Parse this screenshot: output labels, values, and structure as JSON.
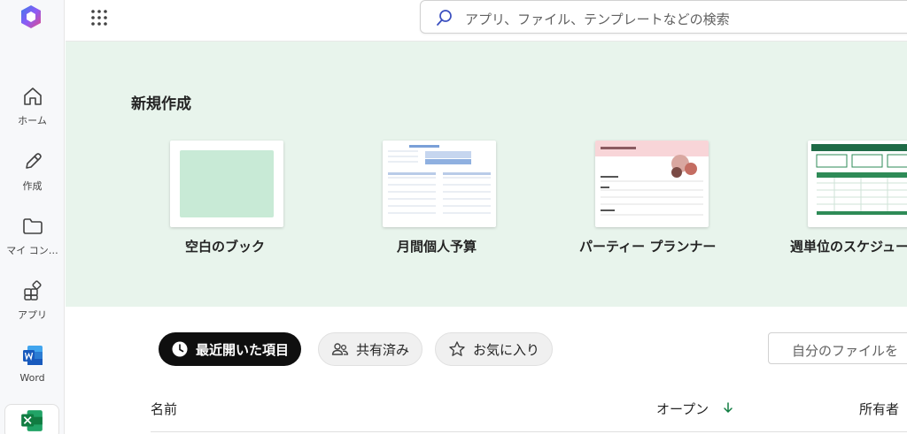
{
  "rail": {
    "items": [
      {
        "label": "ホーム",
        "icon": "home-icon"
      },
      {
        "label": "作成",
        "icon": "pen-icon"
      },
      {
        "label": "マイ コン…",
        "icon": "folder-icon"
      },
      {
        "label": "アプリ",
        "icon": "apps-icon"
      },
      {
        "label": "Word",
        "icon": "word-icon"
      }
    ],
    "excel_icon": "excel-icon"
  },
  "header": {
    "search_placeholder": "アプリ、ファイル、テンプレートなどの検索"
  },
  "hero": {
    "title": "新規作成",
    "templates": [
      {
        "name": "空白のブック"
      },
      {
        "name": "月間個人予算"
      },
      {
        "name": "パーティー プランナー"
      },
      {
        "name": "週単位のスケジュー"
      }
    ]
  },
  "filters": {
    "recent": "最近開いた項目",
    "shared": "共有済み",
    "favorites": "お気に入り",
    "search_placeholder": "自分のファイルを"
  },
  "table": {
    "col_name": "名前",
    "col_opened": "オープン",
    "col_owner": "所有者"
  },
  "colors": {
    "accent_green": "#107c41",
    "hero_bg": "#e8f4ec",
    "word_blue": "#185abd"
  }
}
